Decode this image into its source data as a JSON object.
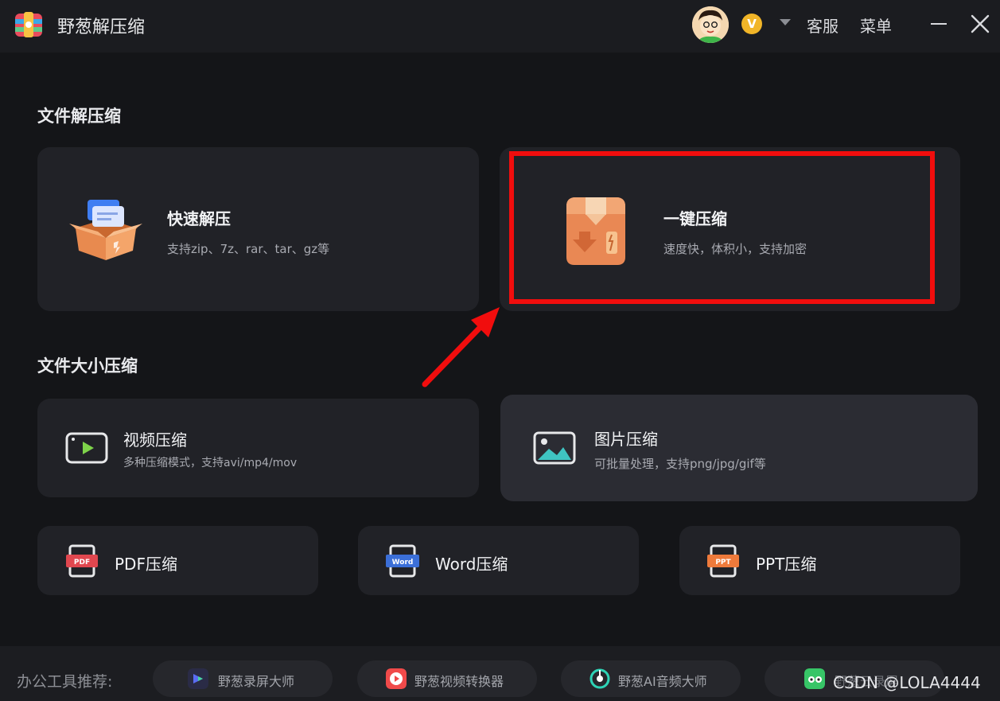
{
  "app": {
    "title": "野葱解压缩"
  },
  "titlebar": {
    "service_label": "客服",
    "menu_label": "菜单",
    "vip_label": "V"
  },
  "sections": {
    "extract_title": "文件解压缩",
    "size_title": "文件大小压缩"
  },
  "cards": {
    "quick_extract": {
      "title": "快速解压",
      "subtitle": "支持zip、7z、rar、tar、gz等"
    },
    "one_click_compress": {
      "title": "一键压缩",
      "subtitle": "速度快，体积小，支持加密"
    },
    "video_compress": {
      "title": "视频压缩",
      "subtitle": "多种压缩模式，支持avi/mp4/mov"
    },
    "image_compress": {
      "title": "图片压缩",
      "subtitle": "可批量处理，支持png/jpg/gif等"
    },
    "pdf_compress": {
      "title": "PDF压缩",
      "badge": "PDF"
    },
    "word_compress": {
      "title": "Word压缩",
      "badge": "Word"
    },
    "ppt_compress": {
      "title": "PPT压缩",
      "badge": "PPT"
    }
  },
  "footer": {
    "label": "办公工具推荐:",
    "tools": [
      {
        "label": "野葱录屏大师"
      },
      {
        "label": "野葱视频转换器"
      },
      {
        "label": "野葱AI音频大师"
      },
      {
        "label": "野葱云录屏"
      }
    ]
  },
  "watermark": "CSDN @LOLA4444",
  "colors": {
    "background": "#141518",
    "card": "#212227",
    "card_active": "#2b2c33",
    "highlight": "#f10d0d",
    "pdf_badge": "#e0474f",
    "word_badge": "#3b6fd8",
    "ppt_badge": "#ee7a3b"
  }
}
